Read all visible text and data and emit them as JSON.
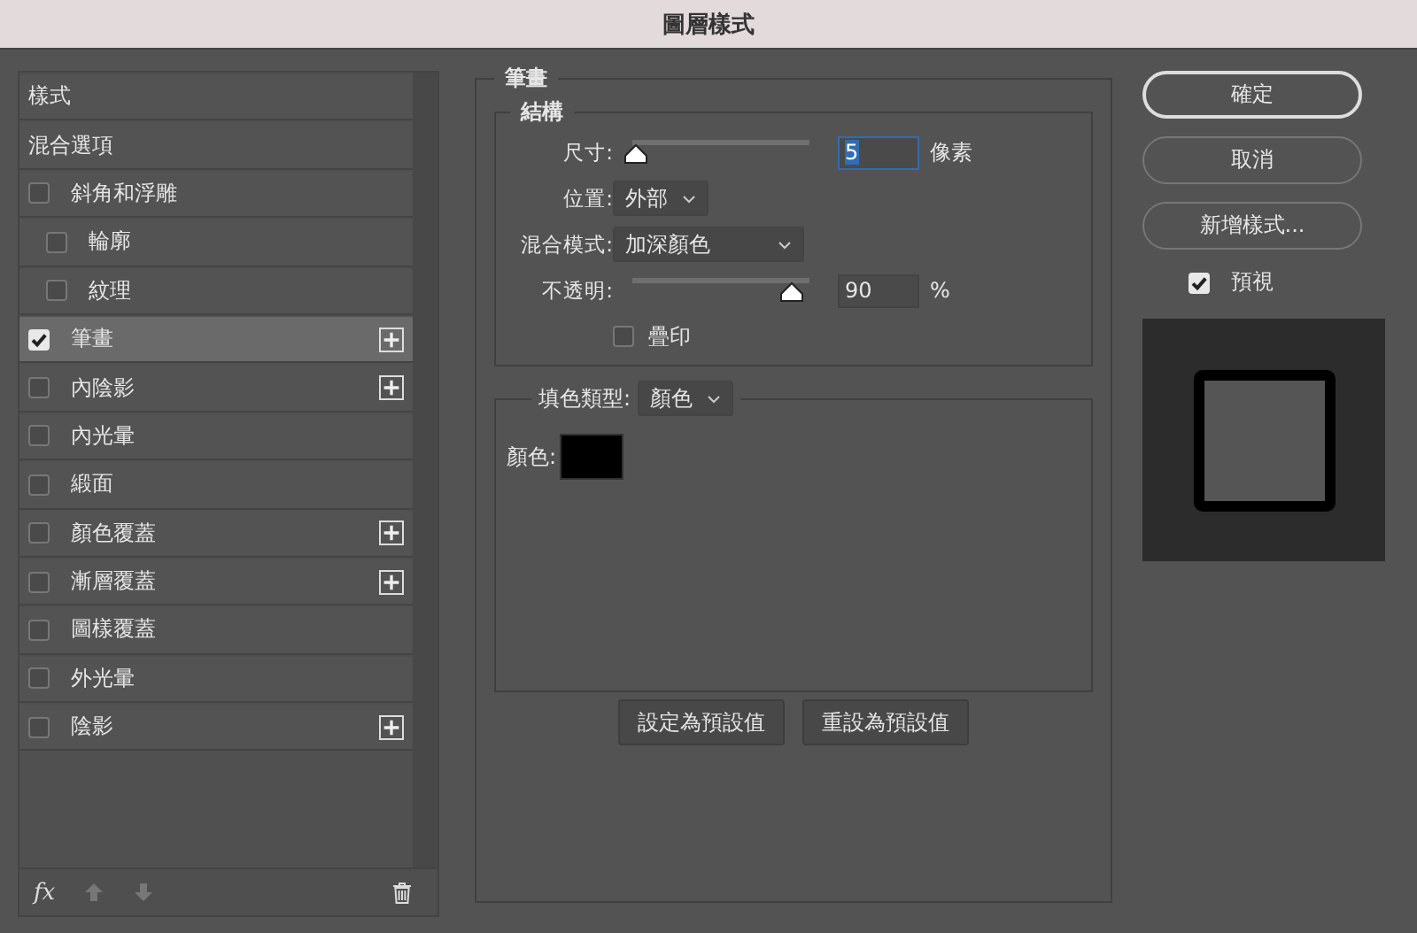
{
  "window": {
    "title": "圖層樣式"
  },
  "styles_list": [
    {
      "label": "樣式",
      "kind": "header",
      "selected": false
    },
    {
      "label": "混合選項",
      "kind": "header",
      "selected": false
    },
    {
      "label": "斜角和浮雕",
      "kind": "checkbox",
      "checked": false,
      "selected": false,
      "plus": false,
      "children": [
        {
          "label": "輪廓",
          "kind": "checkbox",
          "checked": false,
          "selected": false,
          "plus": false
        },
        {
          "label": "紋理",
          "kind": "checkbox",
          "checked": false,
          "selected": false,
          "plus": false
        }
      ]
    },
    {
      "label": "筆畫",
      "kind": "checkbox",
      "checked": true,
      "selected": true,
      "plus": true
    },
    {
      "label": "內陰影",
      "kind": "checkbox",
      "checked": false,
      "selected": false,
      "plus": true
    },
    {
      "label": "內光暈",
      "kind": "checkbox",
      "checked": false,
      "selected": false,
      "plus": false
    },
    {
      "label": "緞面",
      "kind": "checkbox",
      "checked": false,
      "selected": false,
      "plus": false
    },
    {
      "label": "顏色覆蓋",
      "kind": "checkbox",
      "checked": false,
      "selected": false,
      "plus": true
    },
    {
      "label": "漸層覆蓋",
      "kind": "checkbox",
      "checked": false,
      "selected": false,
      "plus": true
    },
    {
      "label": "圖樣覆蓋",
      "kind": "checkbox",
      "checked": false,
      "selected": false,
      "plus": false
    },
    {
      "label": "外光暈",
      "kind": "checkbox",
      "checked": false,
      "selected": false,
      "plus": false
    },
    {
      "label": "陰影",
      "kind": "checkbox",
      "checked": false,
      "selected": false,
      "plus": true
    }
  ],
  "list_toolbar": {
    "fx": "fx"
  },
  "stroke": {
    "title": "筆畫",
    "structure": {
      "title": "結構",
      "size": {
        "label": "尺寸:",
        "level": 0.02,
        "value": "5",
        "focused": true,
        "unit": "像素"
      },
      "position": {
        "label": "位置:",
        "value": "外部"
      },
      "blend_mode": {
        "label": "混合模式:",
        "value": "加深顏色"
      },
      "opacity": {
        "label": "不透明:",
        "level": 0.9,
        "value": "90",
        "focused": false,
        "unit": "%"
      },
      "overprint": {
        "label": "疊印",
        "checked": false
      }
    },
    "fill": {
      "label": "填色類型:",
      "value": "顏色",
      "color_label": "顏色:",
      "color": "#000000"
    },
    "buttons": [
      "設定為預設值",
      "重設為預設值"
    ]
  },
  "actions": [
    {
      "label": "確定",
      "default": true
    },
    {
      "label": "取消",
      "default": false
    },
    {
      "label": "新增樣式...",
      "default": false
    }
  ],
  "preview": {
    "label": "預視",
    "checked": true
  }
}
